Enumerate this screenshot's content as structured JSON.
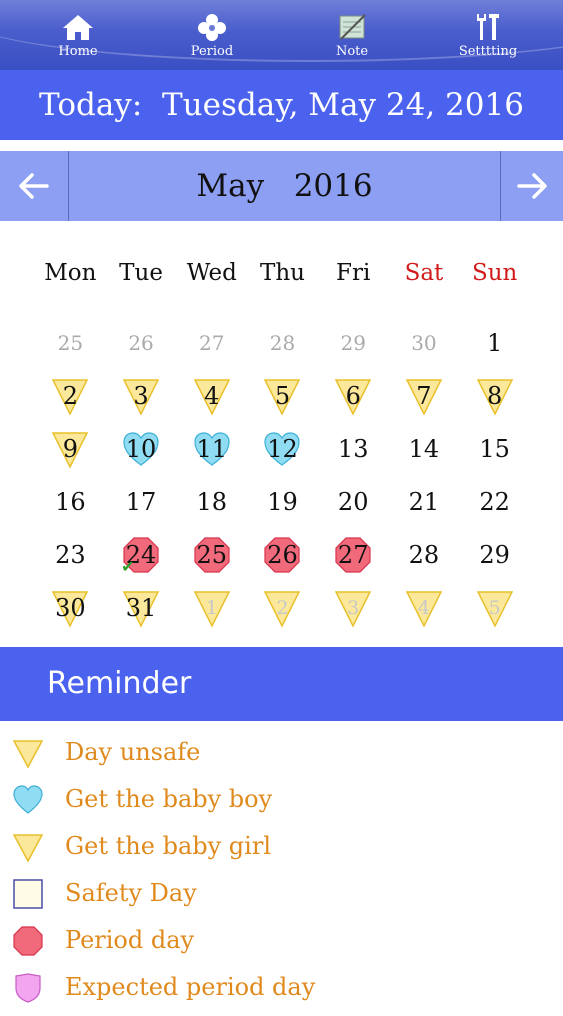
{
  "nav": {
    "items": [
      {
        "label": "Home",
        "icon": "home-icon"
      },
      {
        "label": "Period",
        "icon": "flower-icon"
      },
      {
        "label": "Note",
        "icon": "notepad-icon"
      },
      {
        "label": "Setttting",
        "icon": "tools-icon"
      }
    ]
  },
  "today": {
    "label": "Today:",
    "date": "Tuesday, May 24, 2016"
  },
  "month": {
    "prev_icon": "arrow-left-icon",
    "next_icon": "arrow-right-icon",
    "name": "May",
    "year": "2016"
  },
  "weekdays": [
    "Mon",
    "Tue",
    "Wed",
    "Thu",
    "Fri",
    "Sat",
    "Sun"
  ],
  "calendar": {
    "cells": [
      {
        "day": "25",
        "state": "other",
        "marker": ""
      },
      {
        "day": "26",
        "state": "other",
        "marker": ""
      },
      {
        "day": "27",
        "state": "other",
        "marker": ""
      },
      {
        "day": "28",
        "state": "other",
        "marker": ""
      },
      {
        "day": "29",
        "state": "other",
        "marker": ""
      },
      {
        "day": "30",
        "state": "other",
        "marker": ""
      },
      {
        "day": "1",
        "state": "current",
        "marker": ""
      },
      {
        "day": "2",
        "state": "current",
        "marker": "unsafe"
      },
      {
        "day": "3",
        "state": "current",
        "marker": "unsafe"
      },
      {
        "day": "4",
        "state": "current",
        "marker": "unsafe"
      },
      {
        "day": "5",
        "state": "current",
        "marker": "unsafe"
      },
      {
        "day": "6",
        "state": "current",
        "marker": "unsafe"
      },
      {
        "day": "7",
        "state": "current",
        "marker": "unsafe"
      },
      {
        "day": "8",
        "state": "current",
        "marker": "unsafe"
      },
      {
        "day": "9",
        "state": "current",
        "marker": "unsafe"
      },
      {
        "day": "10",
        "state": "current",
        "marker": "boy"
      },
      {
        "day": "11",
        "state": "current",
        "marker": "boy"
      },
      {
        "day": "12",
        "state": "current",
        "marker": "boy"
      },
      {
        "day": "13",
        "state": "current",
        "marker": ""
      },
      {
        "day": "14",
        "state": "current",
        "marker": ""
      },
      {
        "day": "15",
        "state": "current",
        "marker": ""
      },
      {
        "day": "16",
        "state": "current",
        "marker": ""
      },
      {
        "day": "17",
        "state": "current",
        "marker": ""
      },
      {
        "day": "18",
        "state": "current",
        "marker": ""
      },
      {
        "day": "19",
        "state": "current",
        "marker": ""
      },
      {
        "day": "20",
        "state": "current",
        "marker": ""
      },
      {
        "day": "21",
        "state": "current",
        "marker": ""
      },
      {
        "day": "22",
        "state": "current",
        "marker": ""
      },
      {
        "day": "23",
        "state": "current",
        "marker": ""
      },
      {
        "day": "24",
        "state": "current",
        "marker": "period",
        "today": true
      },
      {
        "day": "25",
        "state": "current",
        "marker": "period"
      },
      {
        "day": "26",
        "state": "current",
        "marker": "period"
      },
      {
        "day": "27",
        "state": "current",
        "marker": "period"
      },
      {
        "day": "28",
        "state": "current",
        "marker": ""
      },
      {
        "day": "29",
        "state": "current",
        "marker": ""
      },
      {
        "day": "30",
        "state": "current",
        "marker": "unsafe"
      },
      {
        "day": "31",
        "state": "current",
        "marker": "unsafe"
      },
      {
        "day": "1",
        "state": "faded",
        "marker": "unsafe"
      },
      {
        "day": "2",
        "state": "faded",
        "marker": "unsafe"
      },
      {
        "day": "3",
        "state": "faded",
        "marker": "unsafe"
      },
      {
        "day": "4",
        "state": "faded",
        "marker": "unsafe"
      },
      {
        "day": "5",
        "state": "faded",
        "marker": "unsafe"
      }
    ],
    "today_mark_icon": "checkmark-icon"
  },
  "reminder": {
    "title": "Reminder",
    "items": [
      {
        "label": "Day unsafe",
        "icon": "yellow-triangle-icon"
      },
      {
        "label": "Get the baby boy",
        "icon": "blue-heart-icon"
      },
      {
        "label": "Get the baby girl",
        "icon": "yellow-triangle-icon"
      },
      {
        "label": "Safety Day",
        "icon": "cream-square-icon"
      },
      {
        "label": "Period day",
        "icon": "red-octagon-icon"
      },
      {
        "label": "Expected period day",
        "icon": "pink-shield-icon"
      }
    ]
  },
  "colors": {
    "header_blue": "#4a62ee",
    "month_bar": "#8d9ff3",
    "weekend_red": "#d01a1a",
    "legend_orange": "#e08a1e",
    "unsafe_yellow": "#fbe89b",
    "boy_blue": "#8fdcf3",
    "period_red": "#f06a7c"
  }
}
